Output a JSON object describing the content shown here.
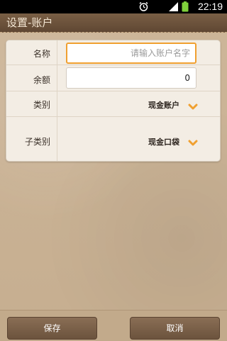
{
  "status_bar": {
    "time": "22:19",
    "icons": [
      "alarm-icon",
      "signal-icon",
      "battery-icon"
    ]
  },
  "header": {
    "title": "设置-账户"
  },
  "form": {
    "name": {
      "label": "名称",
      "value": "",
      "placeholder": "请输入账户名字"
    },
    "balance": {
      "label": "余额",
      "value": "0"
    },
    "category": {
      "label": "类别",
      "value": "现金账户"
    },
    "subcategory": {
      "label": "子类别",
      "value": "现金口袋"
    }
  },
  "footer": {
    "save_label": "保存",
    "cancel_label": "取消"
  },
  "colors": {
    "header_bg": "#6b5240",
    "accent": "#f0a030",
    "button_bg": "#7a5f48"
  }
}
